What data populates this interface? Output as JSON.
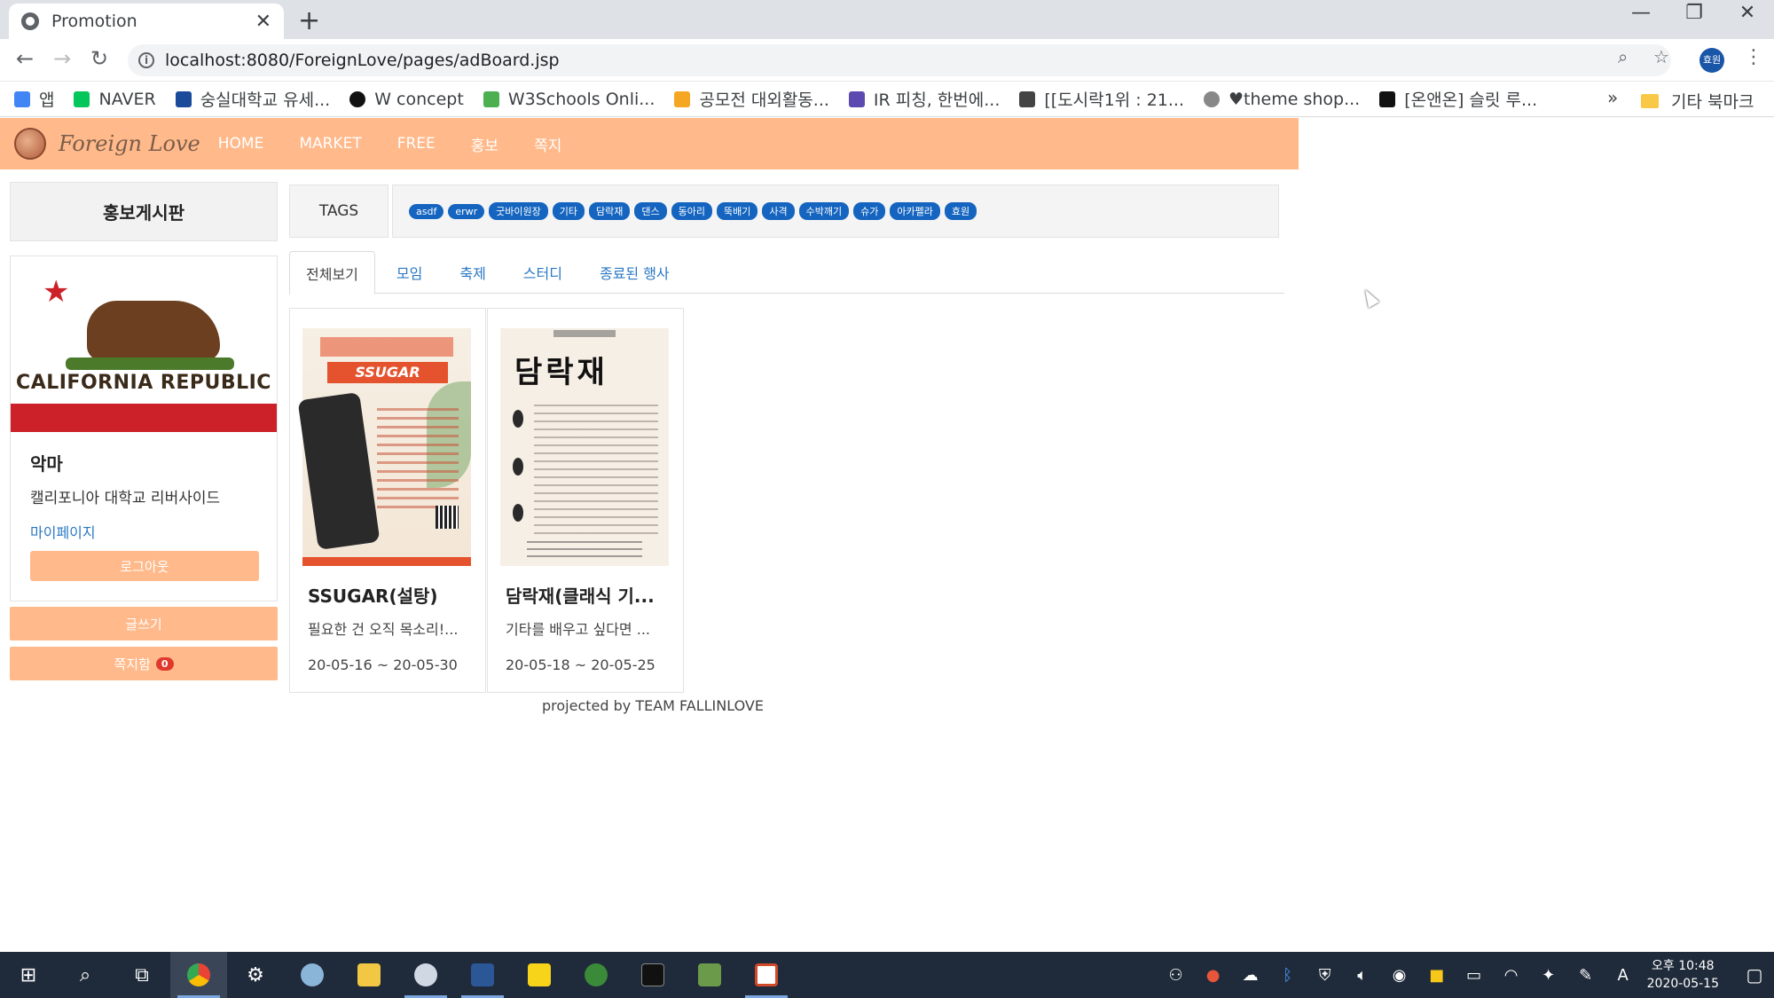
{
  "browser": {
    "tab_title": "Promotion",
    "url": "localhost:8080/ForeignLove/pages/adBoard.jsp",
    "profile_label": "효원",
    "bookmarks": [
      {
        "label": "앱",
        "color": "#4285f4"
      },
      {
        "label": "NAVER",
        "color": "#03c75a"
      },
      {
        "label": "숭실대학교 유세...",
        "color": "#1a4a9a"
      },
      {
        "label": "W concept",
        "color": "#111111"
      },
      {
        "label": "W3Schools Onli...",
        "color": "#4caf50"
      },
      {
        "label": "공모전 대외활동...",
        "color": "#f5a623"
      },
      {
        "label": "IR 피칭, 한번에...",
        "color": "#5c4ab0"
      },
      {
        "label": "[[도시락1위 : 21...",
        "color": "#444444"
      },
      {
        "label": "♥theme shop...",
        "color": "#888888"
      },
      {
        "label": "[온앤온] 슬릿 루...",
        "color": "#111111"
      }
    ],
    "more_bookmarks": "»",
    "other_bookmarks": "기타 북마크"
  },
  "site": {
    "logo": "Foreign Love",
    "nav": [
      "HOME",
      "MARKET",
      "FREE",
      "홍보",
      "쪽지"
    ]
  },
  "sidebar": {
    "board_title": "홍보게시판",
    "flag_text": "CALIFORNIA REPUBLIC",
    "user_name": "악마",
    "school": "캘리포니아 대학교 리버사이드",
    "mypage": "마이페이지",
    "logout": "로그아웃",
    "write": "글쓰기",
    "messages": "쪽지함",
    "message_count": "0"
  },
  "tags": {
    "label": "TAGS",
    "items": [
      "asdf",
      "erwr",
      "굿바이원장",
      "기타",
      "담락재",
      "댄스",
      "동아리",
      "뚝배기",
      "사격",
      "수박깨기",
      "슈가",
      "아카펠라",
      "효원"
    ]
  },
  "category_tabs": [
    "전체보기",
    "모임",
    "축제",
    "스터디",
    "종료된 행사"
  ],
  "posts": [
    {
      "title": "SSUGAR(설탕)",
      "desc": "필요한 건 오직 목소리!...",
      "date": "20-05-16 ~ 20-05-30",
      "poster_banner": "SSUGAR"
    },
    {
      "title": "담락재(클래식 기...",
      "desc": "기타를 배우고 싶다면 ...",
      "date": "20-05-18 ~ 20-05-25",
      "poster_banner": "담락재"
    }
  ],
  "footer": "projected by TEAM FALLINLOVE",
  "taskbar": {
    "clock_time": "오후 10:48",
    "clock_date": "2020-05-15",
    "ime": "A"
  },
  "colors": {
    "accent": "#ffb98a",
    "tag": "#1565c0",
    "link": "#2a78c4",
    "badge": "#e0382d"
  }
}
